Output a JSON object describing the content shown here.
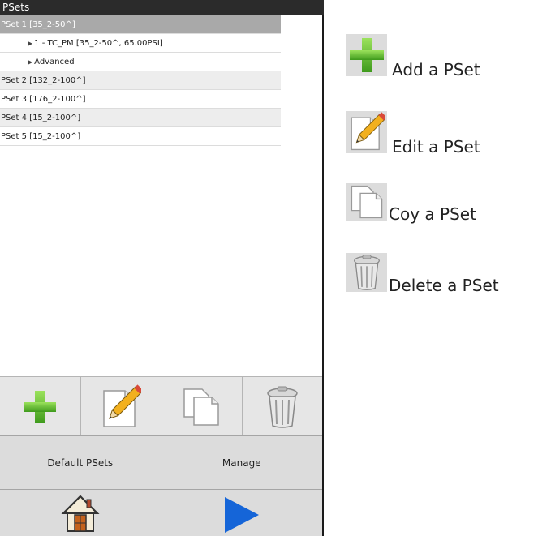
{
  "panel": {
    "title": "PSets",
    "tree": [
      {
        "label": "PSet 1 [35_2-50^]",
        "level": 0,
        "selected": true
      },
      {
        "label": "1 - TC_PM [35_2-50^, 65.00PSI]",
        "level": 1,
        "arrow": true
      },
      {
        "label": "Advanced",
        "level": 1,
        "arrow": true
      },
      {
        "label": "PSet 2 [132_2-100^]",
        "level": 0
      },
      {
        "label": "PSet 3 [176_2-100^]",
        "level": 0
      },
      {
        "label": "PSet 4 [15_2-100^]",
        "level": 0
      },
      {
        "label": "PSet 5 [15_2-100^]",
        "level": 0
      }
    ],
    "toolbar": {
      "add_icon": "plus-icon",
      "edit_icon": "pencil-icon",
      "copy_icon": "copy-icon",
      "delete_icon": "trash-icon"
    },
    "buttons": {
      "default_psets": "Default PSets",
      "manage": "Manage",
      "home_icon": "house-icon",
      "play_icon": "play-icon"
    }
  },
  "legend": {
    "add": "Add a PSet",
    "edit": "Edit a PSet",
    "copy": "Coy a PSet",
    "delete": "Delete a PSet"
  },
  "colors": {
    "title_bar": "#2b2b2b",
    "selected_row": "#a9a9a9",
    "toolbar_bg": "#e6e6e6",
    "button_bg": "#dcdcdc",
    "plus_green": "#5fb830",
    "play_blue": "#1565d8"
  }
}
